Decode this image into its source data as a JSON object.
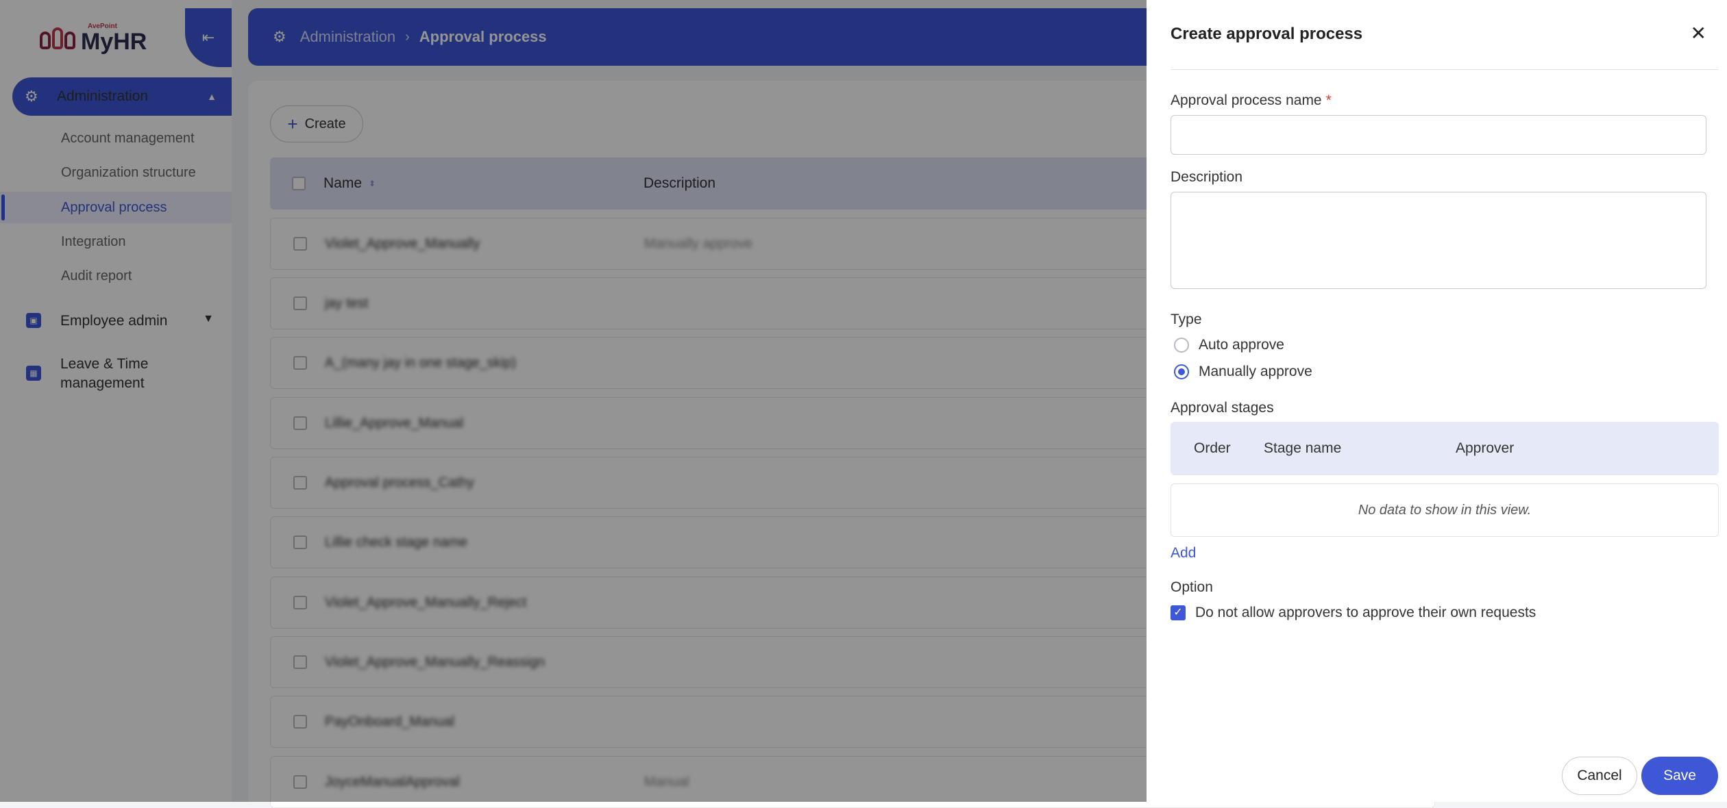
{
  "app": {
    "logo_small": "AvePoint",
    "logo_name": "MyHR"
  },
  "sidebar": {
    "collapse_icon": "collapse-left-icon",
    "admin": {
      "label": "Administration",
      "icon": "gear-icon"
    },
    "admin_items": [
      {
        "label": "Account management"
      },
      {
        "label": "Organization structure"
      },
      {
        "label": "Approval process",
        "active": true
      },
      {
        "label": "Integration"
      },
      {
        "label": "Audit report"
      }
    ],
    "groups": [
      {
        "label": "Employee admin",
        "icon": "badge-icon"
      },
      {
        "label": "Leave & Time management",
        "icon": "calendar-icon"
      }
    ]
  },
  "header": {
    "breadcrumb": [
      "Administration",
      "Approval process"
    ]
  },
  "main": {
    "create_label": "Create",
    "columns": {
      "name": "Name",
      "description": "Description"
    },
    "rows": [
      {
        "name": "Violet_Approve_Manually",
        "description": "Manually approve"
      },
      {
        "name": "jay test",
        "description": ""
      },
      {
        "name": "A_(many jay in one stage_skip)",
        "description": ""
      },
      {
        "name": "Lillie_Approve_Manual",
        "description": ""
      },
      {
        "name": "Approval process_Cathy",
        "description": ""
      },
      {
        "name": "Lillie check stage name",
        "description": ""
      },
      {
        "name": "Violet_Approve_Manually_Reject",
        "description": ""
      },
      {
        "name": "Violet_Approve_Manually_Reassign",
        "description": ""
      },
      {
        "name": "PayOnboard_Manual",
        "description": ""
      },
      {
        "name": "JoyceManualApproval",
        "description": "Manual"
      }
    ]
  },
  "panel": {
    "title": "Create approval process",
    "close_icon": "close-icon",
    "name_label": "Approval process name",
    "required_mark": "*",
    "name_value": "",
    "description_label": "Description",
    "description_value": "",
    "type_label": "Type",
    "type_options": [
      {
        "label": "Auto approve",
        "selected": false
      },
      {
        "label": "Manually approve",
        "selected": true
      }
    ],
    "stages_label": "Approval stages",
    "stages_columns": [
      "Order",
      "Stage name",
      "Approver"
    ],
    "stages_empty": "No data to show in this view.",
    "add_label": "Add",
    "option_label": "Option",
    "option_check": {
      "label": "Do not allow approvers to approve their own requests",
      "checked": true
    },
    "cancel_label": "Cancel",
    "save_label": "Save"
  },
  "colors": {
    "primary": "#3d57d6",
    "required": "#e0392f",
    "brand": "#8c2442"
  }
}
